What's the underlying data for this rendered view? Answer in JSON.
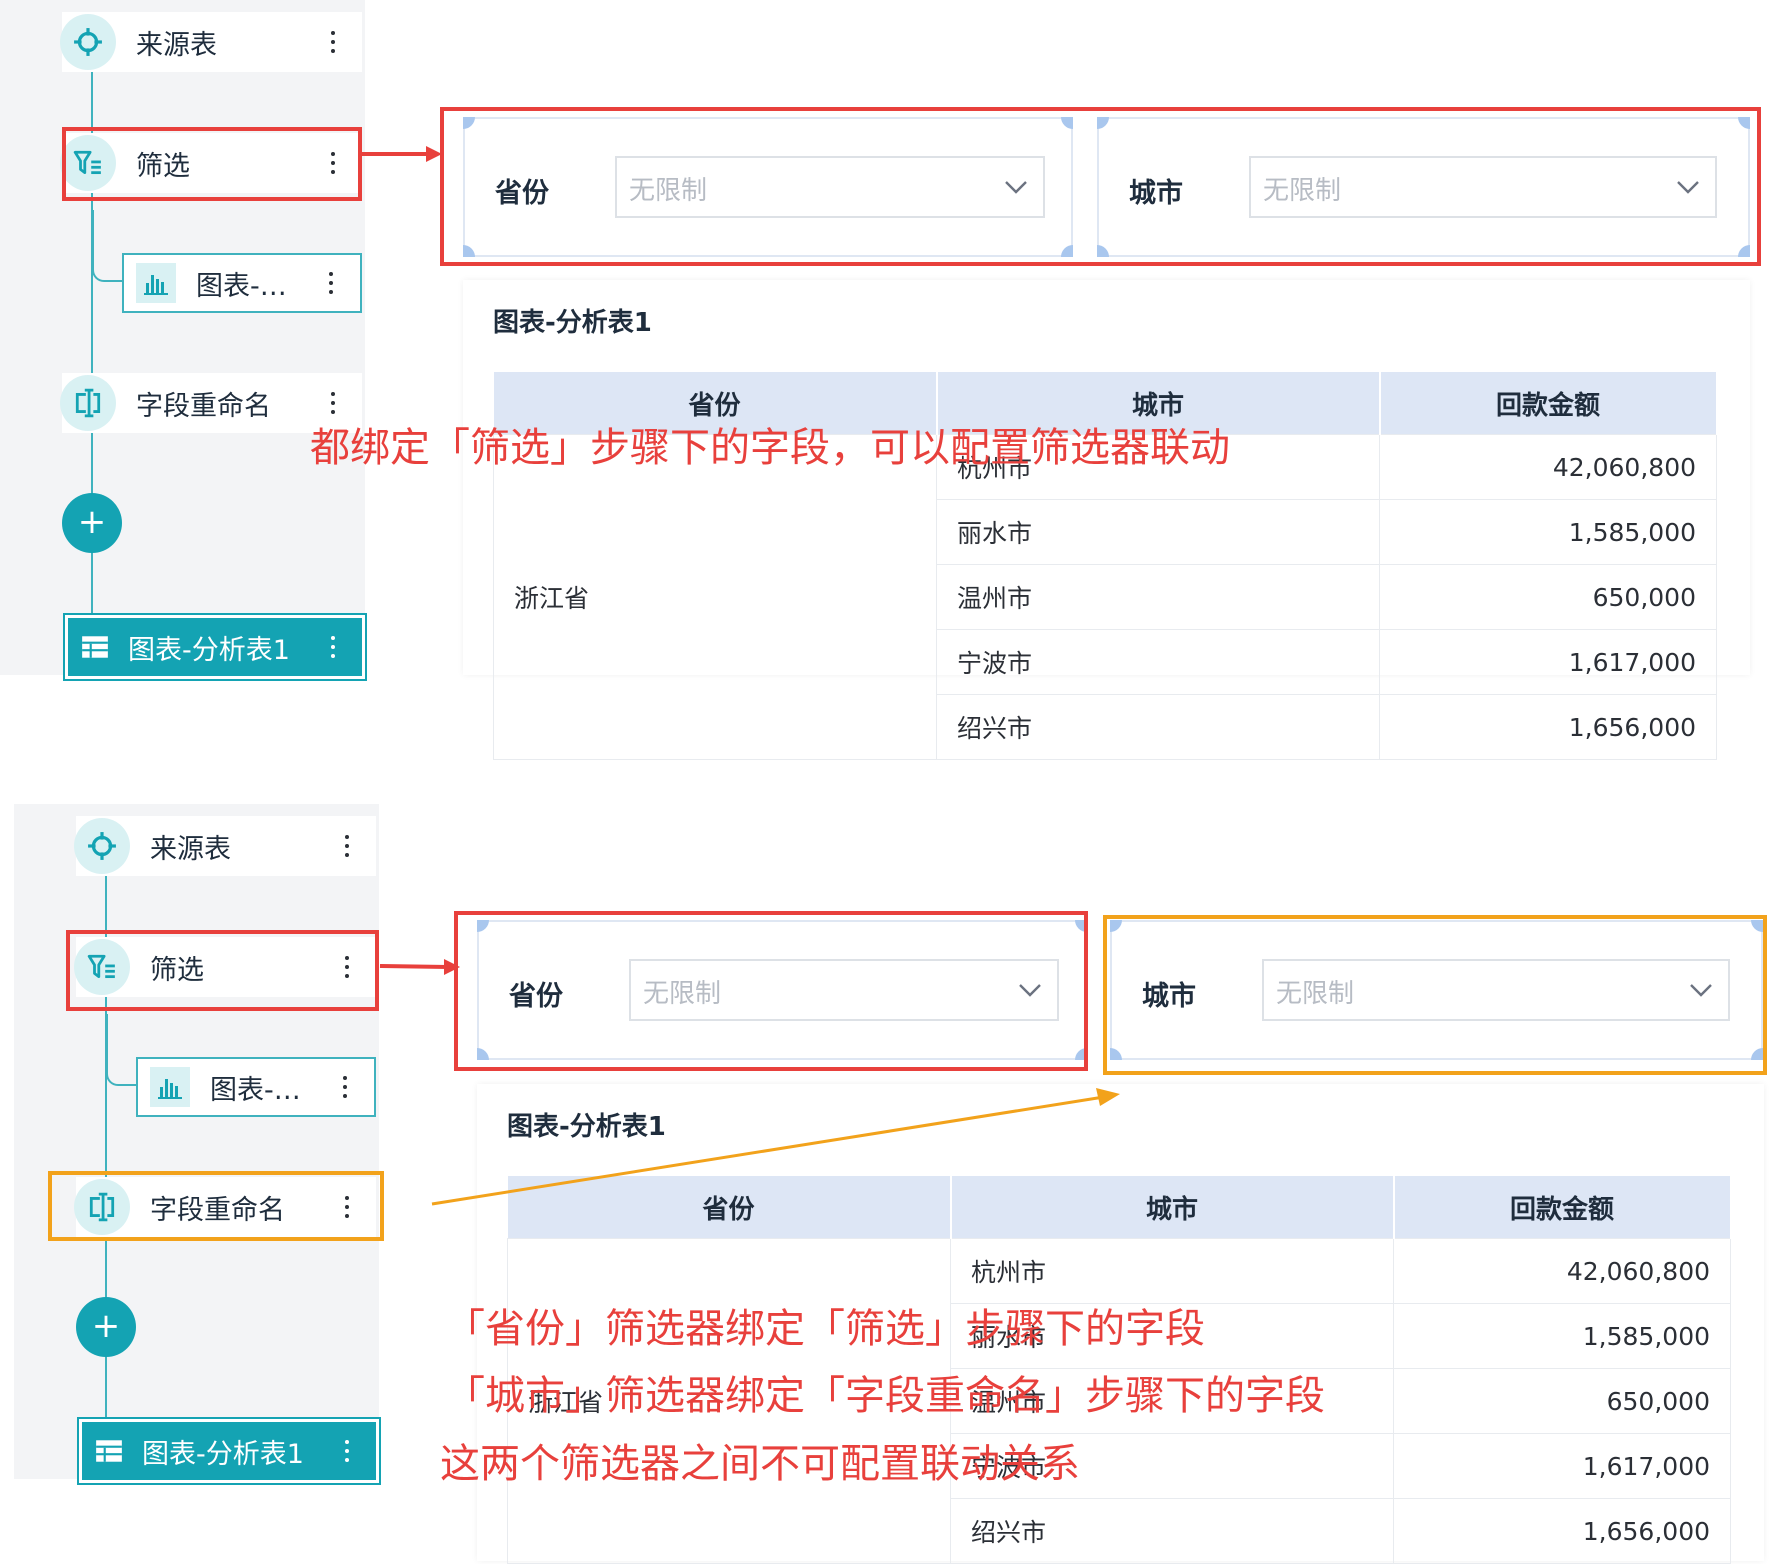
{
  "colors": {
    "accent": "#14a3b3",
    "highlight_red": "#e8403c",
    "highlight_orange": "#f2a21b"
  },
  "steps": {
    "source": {
      "label": "来源表",
      "icon": "crosshair-icon"
    },
    "filter": {
      "label": "筛选",
      "icon": "filter-icon"
    },
    "chart": {
      "label": "图表-…",
      "icon": "bar-chart-icon"
    },
    "rename": {
      "label": "字段重命名",
      "icon": "rename-field-icon"
    },
    "add": {
      "label": "+"
    },
    "table": {
      "label": "图表-分析表1",
      "icon": "table-icon"
    }
  },
  "filters": {
    "province": {
      "label": "省份",
      "placeholder": "无限制"
    },
    "city": {
      "label": "城市",
      "placeholder": "无限制"
    }
  },
  "widget": {
    "title": "图表-分析表1",
    "columns": [
      "省份",
      "城市",
      "回款金额"
    ],
    "group": "浙江省",
    "rows": [
      {
        "city": "杭州市",
        "amount": "42,060,800"
      },
      {
        "city": "丽水市",
        "amount": "1,585,000"
      },
      {
        "city": "温州市",
        "amount": "650,000"
      },
      {
        "city": "宁波市",
        "amount": "1,617,000"
      },
      {
        "city": "绍兴市",
        "amount": "1,656,000"
      }
    ]
  },
  "annotations": {
    "top": "都绑定「筛选」步骤下的字段，可以配置筛选器联动",
    "bottom_line1": "「省份」筛选器绑定「筛选」步骤下的字段",
    "bottom_line2": "「城市」筛选器绑定「字段重命名」步骤下的字段",
    "bottom_line3": "这两个筛选器之间不可配置联动关系"
  }
}
